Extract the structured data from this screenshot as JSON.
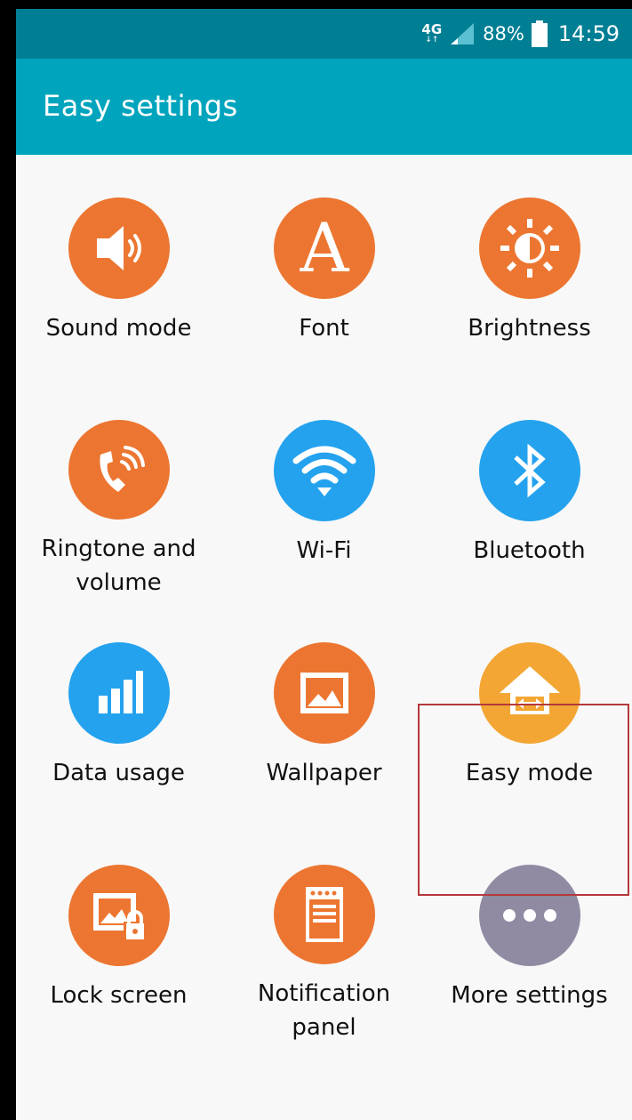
{
  "status": {
    "network": "4G",
    "network_arrows": "↓↑",
    "battery": "88%",
    "time": "14:59"
  },
  "header": {
    "title": "Easy settings"
  },
  "colors": {
    "status_bar": "#007f94",
    "app_bar": "#01a4bd",
    "orange": "#ec7631",
    "blue": "#24a2ee",
    "yellow": "#f3a634",
    "purple": "#908aa3",
    "highlight": "#b5393b"
  },
  "tiles": [
    {
      "label": "Sound mode",
      "icon": "sound-mode-icon"
    },
    {
      "label": "Font",
      "icon": "font-icon"
    },
    {
      "label": "Brightness",
      "icon": "brightness-icon"
    },
    {
      "label": "Ringtone and volume",
      "icon": "ringtone-icon"
    },
    {
      "label": "Wi-Fi",
      "icon": "wifi-icon"
    },
    {
      "label": "Bluetooth",
      "icon": "bluetooth-icon"
    },
    {
      "label": "Data usage",
      "icon": "data-usage-icon"
    },
    {
      "label": "Wallpaper",
      "icon": "wallpaper-icon"
    },
    {
      "label": "Easy mode",
      "icon": "easy-mode-icon"
    },
    {
      "label": "Lock screen",
      "icon": "lock-screen-icon"
    },
    {
      "label": "Notification panel",
      "icon": "notification-panel-icon"
    },
    {
      "label": "More settings",
      "icon": "more-settings-icon"
    }
  ]
}
